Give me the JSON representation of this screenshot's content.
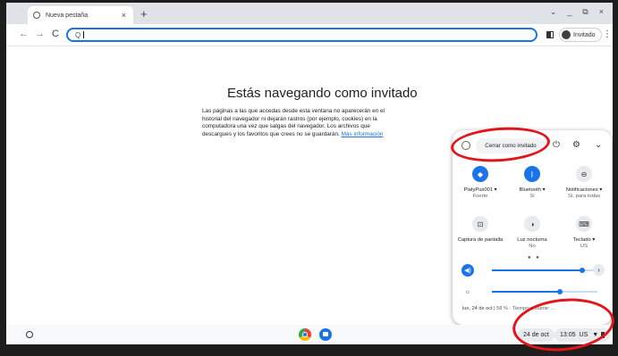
{
  "browser": {
    "tab": {
      "title": "Nueva pestaña",
      "close": "×"
    },
    "new_tab": "+",
    "window_controls": [
      "⌄",
      "_",
      "⧉",
      "×"
    ],
    "nav": {
      "back": "←",
      "forward": "→",
      "reload": "C"
    },
    "omnibox": {
      "icon": "Q",
      "value": ""
    },
    "profile_label": "Invitado",
    "menu": "⋮"
  },
  "page": {
    "title": "Estás navegando como invitado",
    "body": "Las páginas a las que accedas desde esta ventana no aparecerán en el historial del navegador ni dejarán rastros (por ejemplo, cookies) en la computadora una vez que salgas del navegador. Los archivos que descargues y los favoritos que crees no se guardarán. ",
    "link": "Más información"
  },
  "quick_settings": {
    "signout_label": "Cerrar como invitado",
    "tiles": [
      {
        "label": "PlatyPus001 ▾",
        "sub": "Fuerte",
        "glyph": "◆",
        "active": true
      },
      {
        "label": "Bluetooth ▾",
        "sub": "Sí",
        "glyph": "ᛒ",
        "active": true
      },
      {
        "label": "Notificaciones ▾",
        "sub": "Sí, para todas",
        "glyph": "⊖",
        "active": false
      },
      {
        "label": "Captura de pantalla",
        "sub": "",
        "glyph": "⊡",
        "active": false
      },
      {
        "label": "Luz nocturna",
        "sub": "No",
        "glyph": "◑",
        "active": false
      },
      {
        "label": "Teclado ▾",
        "sub": "US",
        "glyph": "⌨",
        "active": false
      }
    ],
    "page_dots": "● ●",
    "volume_level": 0.86,
    "brightness_level": 0.64,
    "footer_date": "lun, 24 de oct",
    "footer_battery": "58 % - Tiempo restante: ...",
    "icons": {
      "power": "⏻",
      "settings": "⚙",
      "collapse": "⌄",
      "next": "›",
      "volume": "◀)",
      "brightness": "☼"
    }
  },
  "shelf": {
    "date": "24 de oct",
    "time": "13:05",
    "keyboard": "US"
  },
  "colors": {
    "accent": "#1a73e8",
    "annotation": "#e3141b"
  }
}
